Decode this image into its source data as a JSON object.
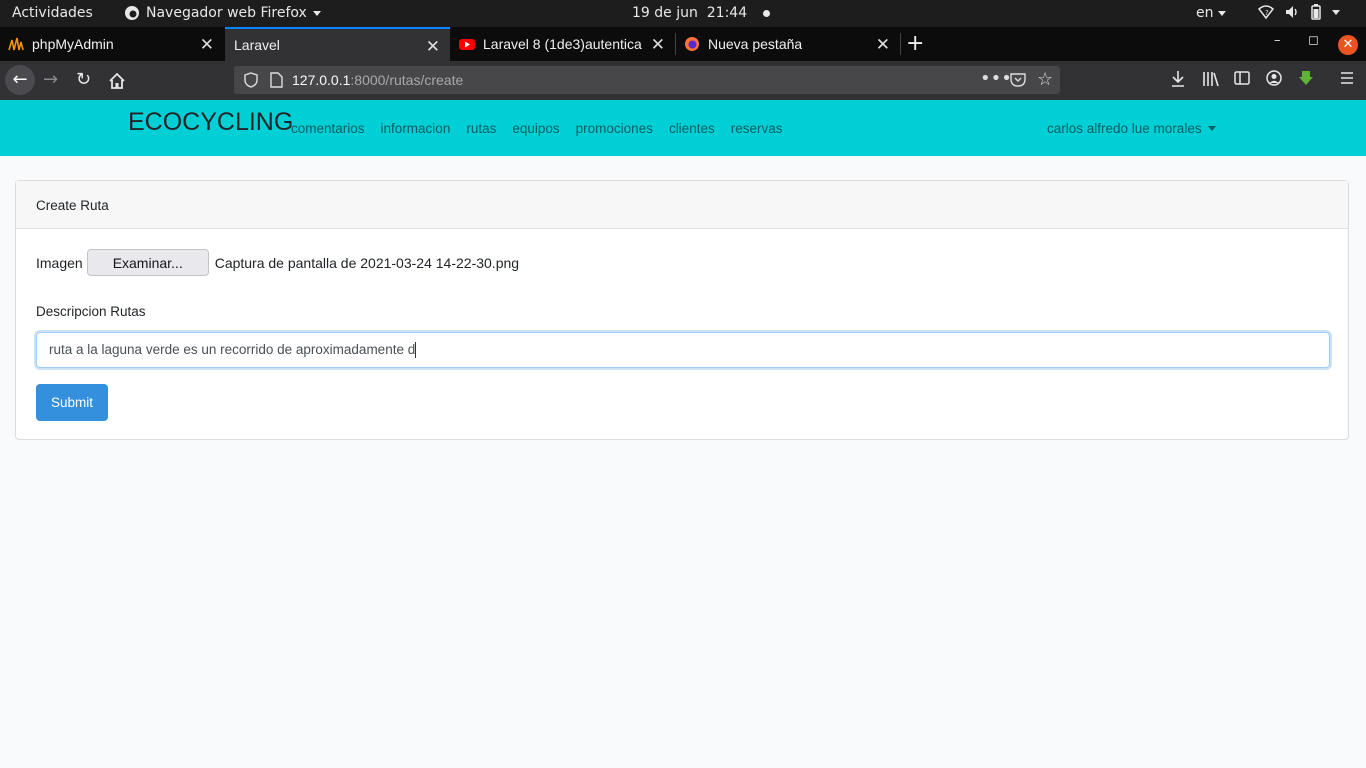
{
  "system_bar": {
    "activities": "Actividades",
    "app_name": "Navegador web Firefox",
    "date": "19 de jun",
    "time": "21:44",
    "language": "en"
  },
  "browser": {
    "tabs": [
      {
        "title": "phpMyAdmin",
        "icon": "phpmyadmin-icon",
        "active": false
      },
      {
        "title": "Laravel",
        "icon": "",
        "active": true
      },
      {
        "title": "Laravel 8 (1de3)autentica",
        "icon": "youtube-icon",
        "active": false
      },
      {
        "title": "Nueva pestaña",
        "icon": "firefox-icon",
        "active": false
      }
    ],
    "url_host": "127.0.0.1",
    "url_path": ":8000/rutas/create"
  },
  "site": {
    "brand": "ECOCYCLING",
    "nav": [
      "comentarios",
      "informacion",
      "rutas",
      "equipos",
      "promociones",
      "clientes",
      "reservas"
    ],
    "user": "carlos alfredo lue morales"
  },
  "form": {
    "header": "Create Ruta",
    "image_label": "Imagen",
    "browse_label": "Examinar...",
    "file_name": "Captura de pantalla de 2021-03-24 14-22-30.png",
    "desc_label": "Descripcion Rutas",
    "desc_value": "ruta a la laguna verde es un recorrido de aproximadamente d",
    "submit_label": "Submit"
  },
  "colors": {
    "site_nav": "#00cfd5",
    "submit": "#3490dc",
    "tab_accent": "#0a84ff",
    "window_close": "#e95420"
  }
}
